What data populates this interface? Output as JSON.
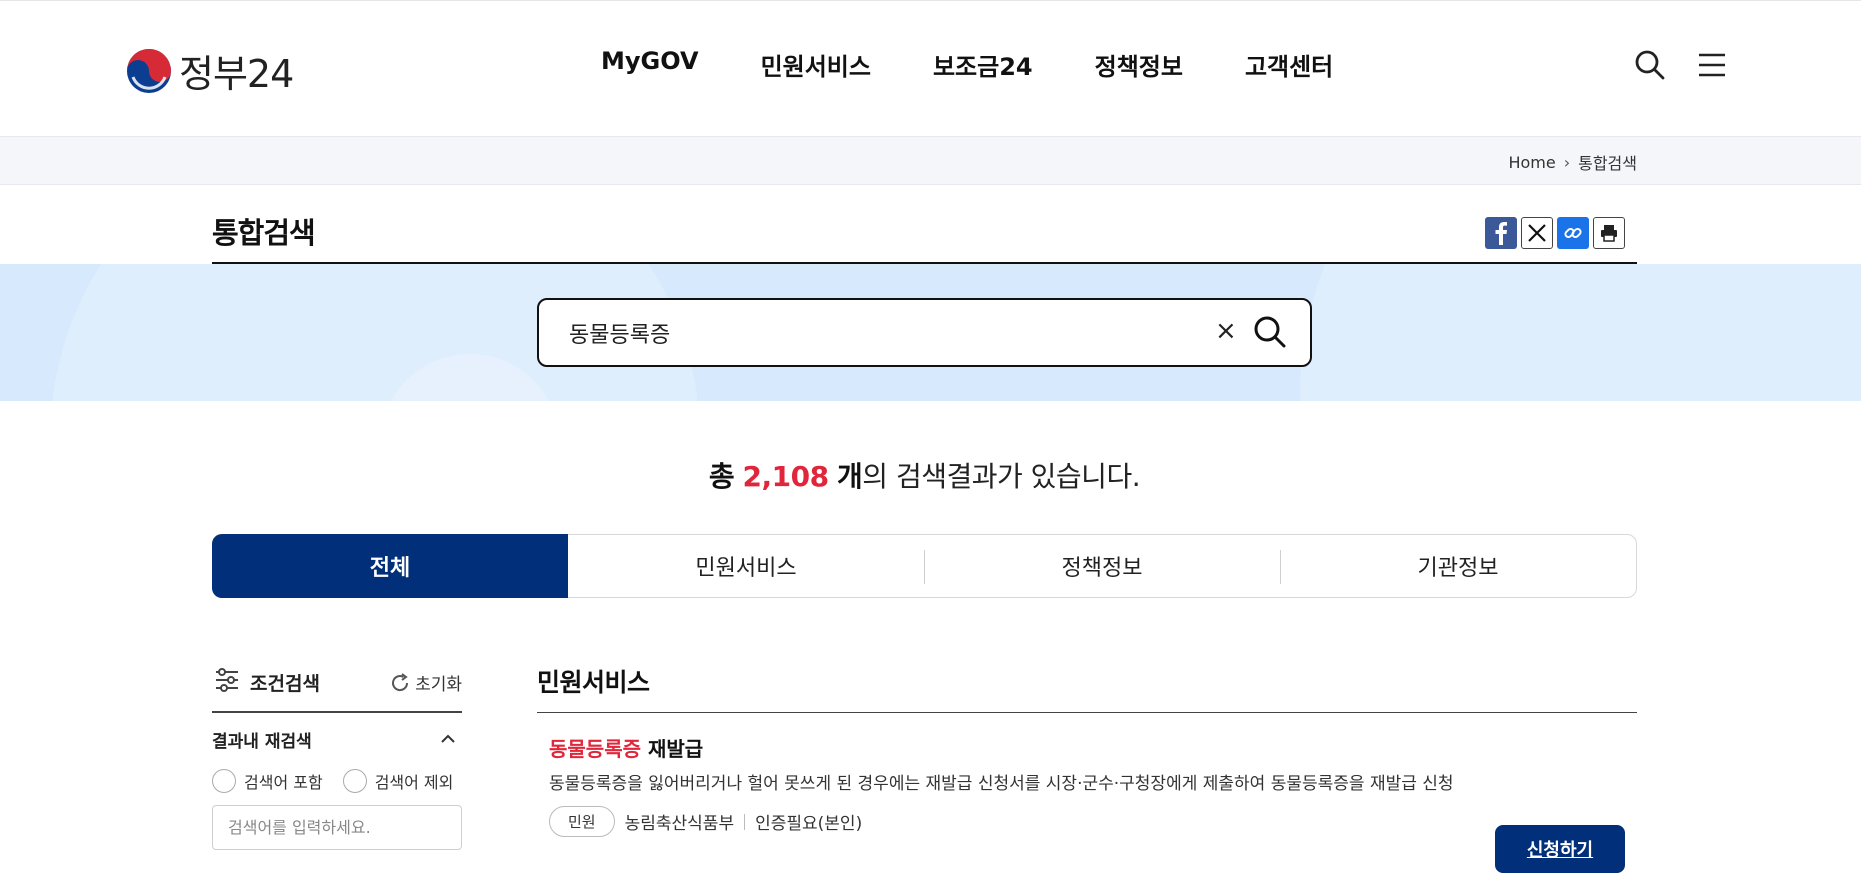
{
  "header": {
    "logo_text": "정부24",
    "nav": [
      "MyGOV",
      "민원서비스",
      "보조금24",
      "정책정보",
      "고객센터"
    ]
  },
  "breadcrumb": {
    "home": "Home",
    "sep": "›",
    "current": "통합검색"
  },
  "page": {
    "title": "통합검색"
  },
  "search": {
    "value": "동물등록증",
    "clear": "×"
  },
  "result_count": {
    "prefix": "총",
    "count": "2,108",
    "unit": "개",
    "suffix": "의 검색결과가 있습니다."
  },
  "tabs": [
    "전체",
    "민원서비스",
    "정책정보",
    "기관정보"
  ],
  "filter": {
    "title": "조건검색",
    "reset": "초기화",
    "subhead": "결과내 재검색",
    "include": "검색어 포함",
    "exclude": "검색어 제외",
    "placeholder": "검색어를 입력하세요."
  },
  "results": {
    "section_title": "민원서비스",
    "items": [
      {
        "title_highlight": "동물등록증",
        "title_rest": " 재발급",
        "desc": "동물등록증을 잃어버리거나 헐어 못쓰게 된 경우에는 재발급 신청서를 시장·군수·구청장에게 제출하여 동물등록증을 재발급 신청",
        "badge": "민원",
        "agency": "농림축산식품부",
        "auth": "인증필요(본인)",
        "apply": "신청하기"
      }
    ]
  },
  "colors": {
    "brand_navy": "#012f79",
    "highlight_red": "#e0263a",
    "band_blue": "#d6e9fd"
  }
}
